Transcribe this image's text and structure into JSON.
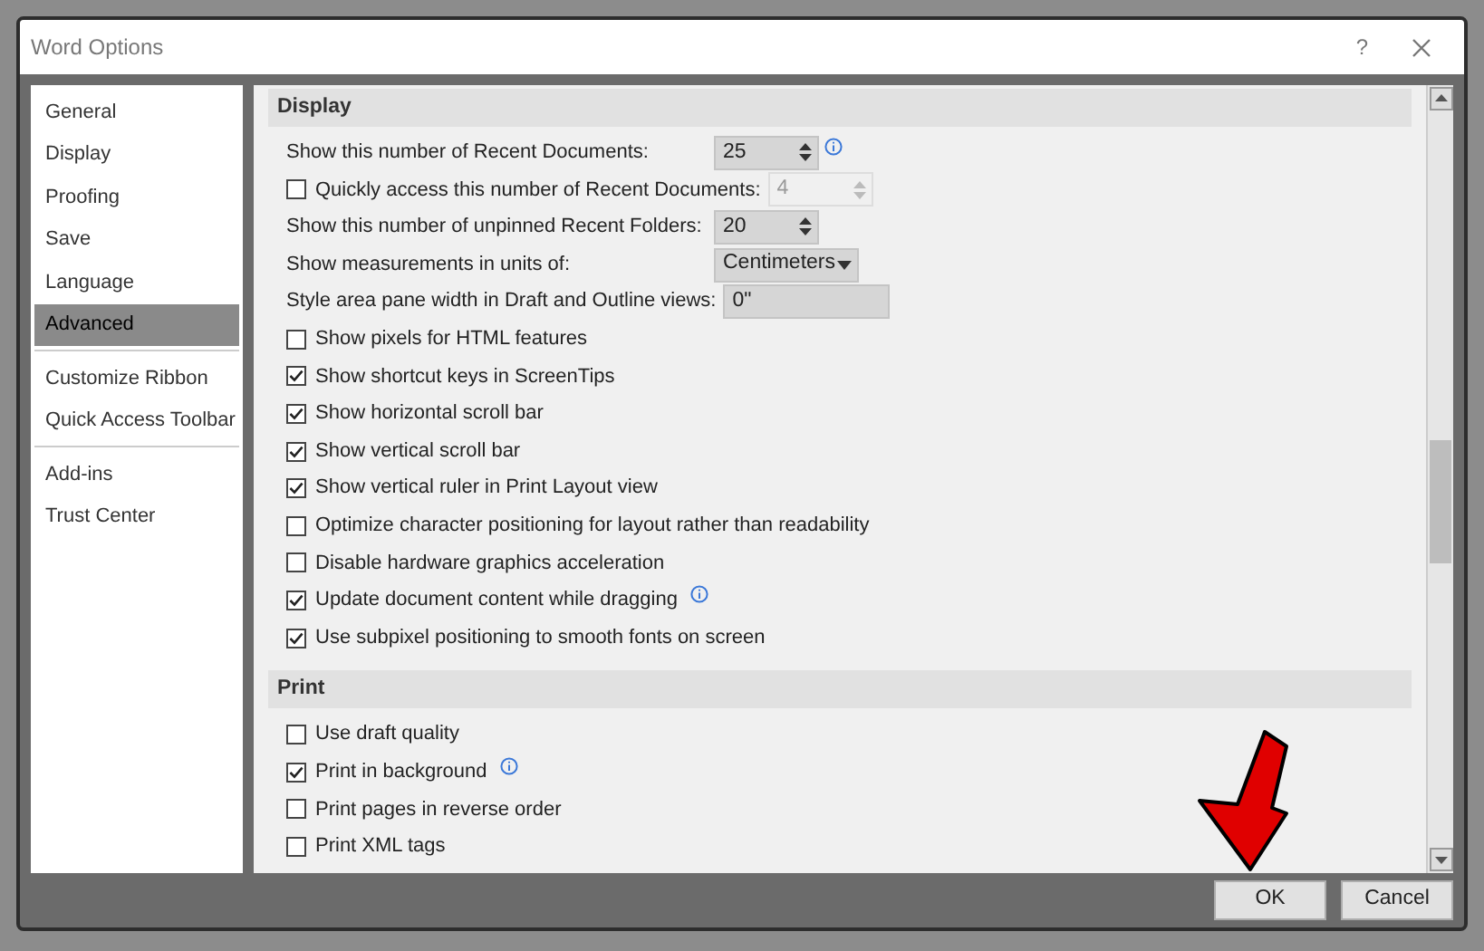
{
  "window": {
    "title": "Word Options",
    "help": "?"
  },
  "sidebar": {
    "groups": [
      [
        {
          "label": "General",
          "selected": false
        },
        {
          "label": "Display",
          "selected": false
        },
        {
          "label": "Proofing",
          "selected": false
        },
        {
          "label": "Save",
          "selected": false
        },
        {
          "label": "Language",
          "selected": false
        },
        {
          "label": "Advanced",
          "selected": true
        }
      ],
      [
        {
          "label": "Customize Ribbon",
          "selected": false
        },
        {
          "label": "Quick Access Toolbar",
          "selected": false
        }
      ],
      [
        {
          "label": "Add-ins",
          "selected": false
        },
        {
          "label": "Trust Center",
          "selected": false
        }
      ]
    ]
  },
  "sections": [
    {
      "title": "Display",
      "rows": [
        {
          "kind": "spinner",
          "label": "Show this number of Recent Documents:",
          "value": "25",
          "info": true,
          "disabled": false
        },
        {
          "kind": "check_spinner",
          "label": "Quickly access this number of Recent Documents:",
          "value": "4",
          "checked": false,
          "disabled": true
        },
        {
          "kind": "spinner",
          "label": "Show this number of unpinned Recent Folders:",
          "value": "20",
          "info": false,
          "disabled": false
        },
        {
          "kind": "dropdown",
          "label": "Show measurements in units of:",
          "value": "Centimeters"
        },
        {
          "kind": "textbox",
          "label": "Style area pane width in Draft and Outline views:",
          "value": "0\""
        },
        {
          "kind": "checkbox",
          "label": "Show pixels for HTML features",
          "checked": false,
          "info": false
        },
        {
          "kind": "checkbox",
          "label": "Show shortcut keys in ScreenTips",
          "checked": true,
          "info": false
        },
        {
          "kind": "checkbox",
          "label": "Show horizontal scroll bar",
          "checked": true,
          "info": false
        },
        {
          "kind": "checkbox",
          "label": "Show vertical scroll bar",
          "checked": true,
          "info": false
        },
        {
          "kind": "checkbox",
          "label": "Show vertical ruler in Print Layout view",
          "checked": true,
          "info": false
        },
        {
          "kind": "checkbox",
          "label": "Optimize character positioning for layout rather than readability",
          "checked": false,
          "info": false
        },
        {
          "kind": "checkbox",
          "label": "Disable hardware graphics acceleration",
          "checked": false,
          "info": false
        },
        {
          "kind": "checkbox",
          "label": "Update document content while dragging",
          "checked": true,
          "info": true
        },
        {
          "kind": "checkbox",
          "label": "Use subpixel positioning to smooth fonts on screen",
          "checked": true,
          "info": false
        }
      ]
    },
    {
      "title": "Print",
      "rows": [
        {
          "kind": "checkbox",
          "label": "Use draft quality",
          "checked": false,
          "info": false
        },
        {
          "kind": "checkbox",
          "label": "Print in background",
          "checked": true,
          "info": true
        },
        {
          "kind": "checkbox",
          "label": "Print pages in reverse order",
          "checked": false,
          "info": false
        },
        {
          "kind": "checkbox",
          "label": "Print XML tags",
          "checked": false,
          "info": false
        }
      ]
    }
  ],
  "buttons": [
    "OK",
    "Cancel"
  ]
}
